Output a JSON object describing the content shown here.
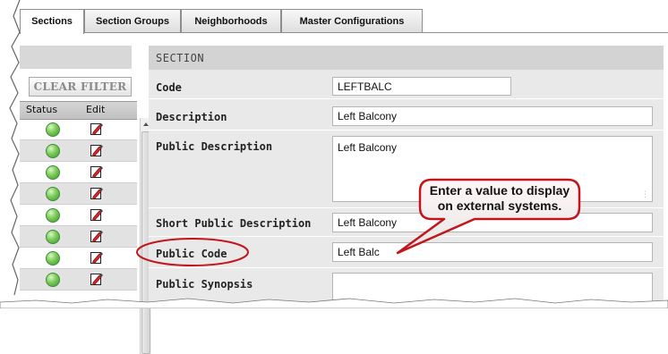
{
  "tabs": [
    {
      "label": "Sections",
      "active": true
    },
    {
      "label": "Section Groups",
      "active": false
    },
    {
      "label": "Neighborhoods",
      "active": false
    },
    {
      "label": "Master Configurations",
      "active": false
    }
  ],
  "left": {
    "clear_filter_label": "CLEAR FILTER",
    "columns": [
      "Status",
      "Edit"
    ],
    "rows": [
      {
        "status": "active-green-icon",
        "edit": "edit-pencil-icon"
      },
      {
        "status": "active-green-icon",
        "edit": "edit-pencil-icon"
      },
      {
        "status": "active-green-icon",
        "edit": "edit-pencil-icon"
      },
      {
        "status": "active-green-icon",
        "edit": "edit-pencil-icon"
      },
      {
        "status": "active-green-icon",
        "edit": "edit-pencil-icon"
      },
      {
        "status": "active-green-icon",
        "edit": "edit-pencil-icon"
      },
      {
        "status": "active-green-icon",
        "edit": "edit-pencil-icon"
      },
      {
        "status": "active-green-icon",
        "edit": "edit-pencil-icon"
      }
    ]
  },
  "form": {
    "title": "SECTION",
    "fields": {
      "code": {
        "label": "Code",
        "value": "LEFTBALC"
      },
      "description": {
        "label": "Description",
        "value": "Left Balcony"
      },
      "public_description": {
        "label": "Public Description",
        "value": "Left Balcony"
      },
      "short_public_description": {
        "label": "Short Public Description",
        "value": "Left Balcony"
      },
      "public_code": {
        "label": "Public Code",
        "value": "Left Balc"
      },
      "public_synopsis": {
        "label": "Public Synopsis",
        "value": ""
      }
    }
  },
  "annotation": {
    "line1": "Enter a value to display",
    "line2": "on external systems.",
    "callout_color": "#c0161c",
    "fill_top": "#fff6f6",
    "fill_bottom": "#e6e6e6"
  },
  "colors": {
    "status_green": "#3e9a32",
    "panel_gray": "#e9e9e9",
    "header_gray": "#d3d3d3"
  }
}
